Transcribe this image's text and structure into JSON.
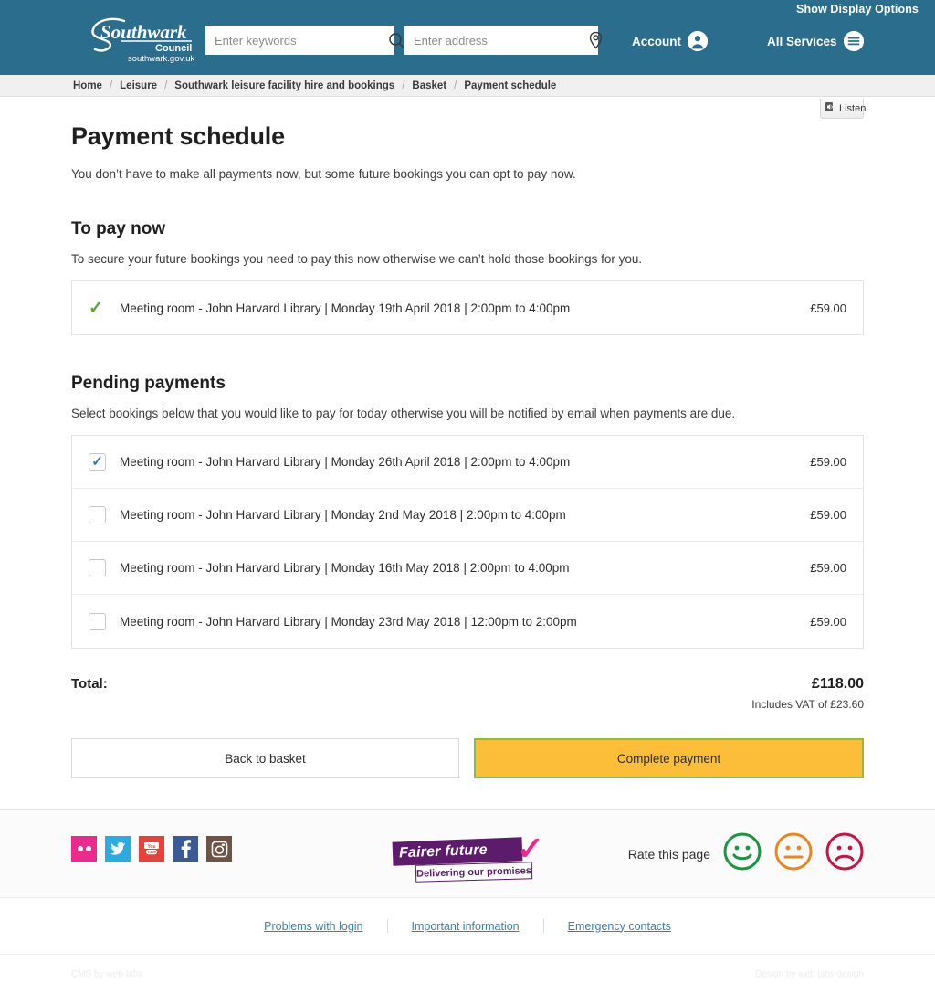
{
  "header": {
    "show_display_options": "Show Display Options",
    "logo": {
      "wordmark": "Southwark",
      "council": "Council",
      "domain": "southwark.gov.uk"
    },
    "search_keywords": {
      "value": "",
      "placeholder": "Enter keywords",
      "icon": "search-icon"
    },
    "search_address": {
      "value": "",
      "placeholder": "Enter address",
      "icon": "map-pin-icon"
    },
    "account_label": "Account",
    "account_icon": "user-icon",
    "services_label": "All Services",
    "services_icon": "hamburger-menu-icon",
    "background": "#2a6d8d"
  },
  "breadcrumb": {
    "items": [
      "Home",
      "Leisure",
      "Southwark leisure facility hire and bookings",
      "Basket",
      "Payment schedule"
    ],
    "separator": "/"
  },
  "listen": {
    "label": "Listen",
    "icon": "speaker-icon"
  },
  "main": {
    "title": "Payment schedule",
    "intro": "You don’t have to make all payments now, but some future bookings you can opt to pay now.",
    "to_pay_now": {
      "heading": "To pay now",
      "description": "To secure your future bookings you need to pay this now otherwise we can’t hold those bookings for you.",
      "rows": [
        {
          "mark": "tick-green",
          "label": "Meeting room - John Harvard Library |  Monday 19th April 2018  |  2:00pm to 4:00pm",
          "price": "£59.00"
        }
      ]
    },
    "pending_payments": {
      "heading": "Pending payments",
      "description": "Select bookings below that you would like to pay for today otherwise you will be notified by email when payments are due.",
      "rows": [
        {
          "checked": true,
          "label": "Meeting room - John Harvard Library |  Monday 26th April 2018  |  2:00pm to 4:00pm",
          "price": "£59.00"
        },
        {
          "checked": false,
          "label": "Meeting room - John Harvard Library |  Monday 2nd May 2018  |  2:00pm to 4:00pm",
          "price": "£59.00"
        },
        {
          "checked": false,
          "label": "Meeting room - John Harvard Library |  Monday 16th May 2018  |  2:00pm to 4:00pm",
          "price": "£59.00"
        },
        {
          "checked": false,
          "label": "Meeting room - John Harvard Library |  Monday 23rd May 2018  |  12:00pm to 2:00pm",
          "price": "£59.00"
        }
      ]
    },
    "totals": {
      "label": "Total:",
      "amount": "£118.00",
      "vat": "Includes VAT of £23.60"
    },
    "buttons": {
      "back": "Back to basket",
      "complete": "Complete payment",
      "complete_background": "#fcbe38",
      "complete_border": "#8dbd3a"
    }
  },
  "footer": {
    "social": [
      {
        "name": "flickr",
        "color": "#ec2a8e"
      },
      {
        "name": "twitter",
        "color": "#2cabe2"
      },
      {
        "name": "youtube",
        "color": "#e8413a"
      },
      {
        "name": "facebook",
        "color": "#3a5a96"
      },
      {
        "name": "instagram",
        "color": "#6d5444"
      }
    ],
    "fairer_future": {
      "line1": "Fairer future",
      "line2": "Delivering our promises",
      "purple": "#5c1b6b",
      "pink": "#ec2a8e"
    },
    "rate": {
      "label": "Rate this page",
      "faces": [
        {
          "name": "happy",
          "color": "#1a9641"
        },
        {
          "name": "neutral",
          "color": "#e8871f"
        },
        {
          "name": "sad",
          "color": "#cc1243"
        }
      ]
    },
    "links": [
      "Problems with login",
      "Important information",
      "Emergency contacts"
    ],
    "credits": {
      "left": "CMS by web-labs",
      "right": "Design by web labs design"
    }
  }
}
